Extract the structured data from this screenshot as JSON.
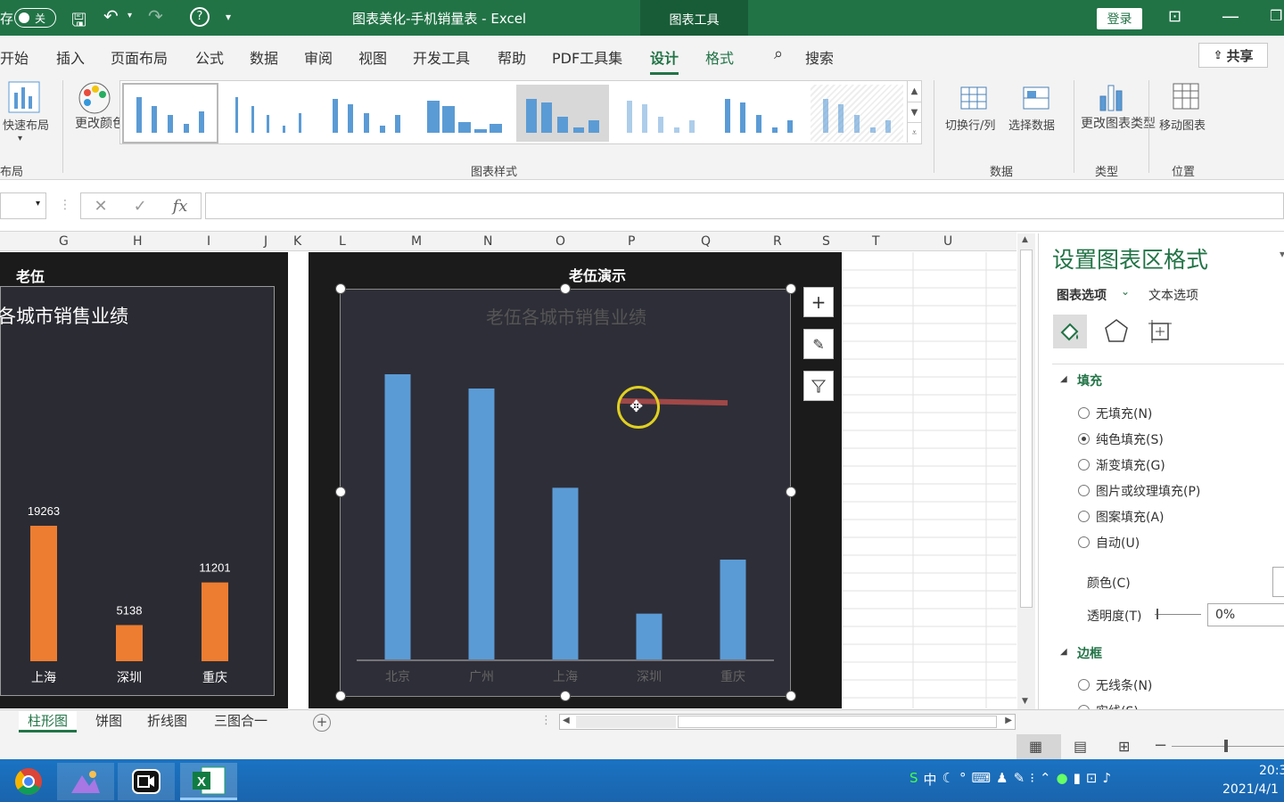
{
  "titlebar": {
    "autosave_label": "存",
    "autosave_state": "关",
    "doc_title": "图表美化-手机销量表 - Excel",
    "context_tab": "图表工具",
    "login": "登录"
  },
  "tabs": {
    "items": [
      "开始",
      "插入",
      "页面布局",
      "公式",
      "数据",
      "审阅",
      "视图",
      "开发工具",
      "帮助",
      "PDF工具集",
      "设计",
      "格式"
    ],
    "active": "设计",
    "search": "搜索",
    "share": "共享"
  },
  "ribbon": {
    "quick_layout": "快速布局",
    "change_colors": "更改颜色",
    "group_layout": "布局",
    "group_styles": "图表样式",
    "switch_row_col": "切换行/列",
    "select_data": "选择数据",
    "group_data": "数据",
    "change_type": "更改图表类型",
    "group_type": "类型",
    "move_chart": "移动图表",
    "group_location": "位置"
  },
  "formula_bar": {
    "fx": "fx"
  },
  "columns": [
    "G",
    "H",
    "I",
    "J",
    "K",
    "L",
    "M",
    "N",
    "O",
    "P",
    "Q",
    "R",
    "S",
    "T",
    "U"
  ],
  "left_block": {
    "header": "老伍",
    "chart_title": "各城市销售业绩"
  },
  "right_block": {
    "header": "老伍演示",
    "chart_title": "老伍各城市销售业绩"
  },
  "chart_data": [
    {
      "type": "bar",
      "title": "各城市销售业绩",
      "categories": [
        "上海",
        "深圳",
        "重庆"
      ],
      "values": [
        19263,
        5138,
        11201
      ],
      "color": "#ed7d31"
    },
    {
      "type": "bar",
      "title": "老伍各城市销售业绩",
      "categories": [
        "北京",
        "广州",
        "上海",
        "深圳",
        "重庆"
      ],
      "values": [
        32000,
        30400,
        19263,
        5138,
        11201
      ],
      "color": "#5b9bd5"
    }
  ],
  "pane": {
    "title": "设置图表区格式",
    "tab_chart": "图表选项",
    "tab_text": "文本选项",
    "fill_header": "填充",
    "fill_options": [
      "无填充(N)",
      "纯色填充(S)",
      "渐变填充(G)",
      "图片或纹理填充(P)",
      "图案填充(A)",
      "自动(U)"
    ],
    "fill_selected": 1,
    "color_label": "颜色(C)",
    "transparency_label": "透明度(T)",
    "transparency_value": "0%",
    "border_header": "边框",
    "border_options": [
      "无线条(N)",
      "实线(S)"
    ]
  },
  "sheets": {
    "items": [
      "柱形图",
      "饼图",
      "折线图",
      "三图合一"
    ],
    "active": "柱形图"
  },
  "clock": {
    "time": "20:3",
    "date": "2021/4/1"
  }
}
